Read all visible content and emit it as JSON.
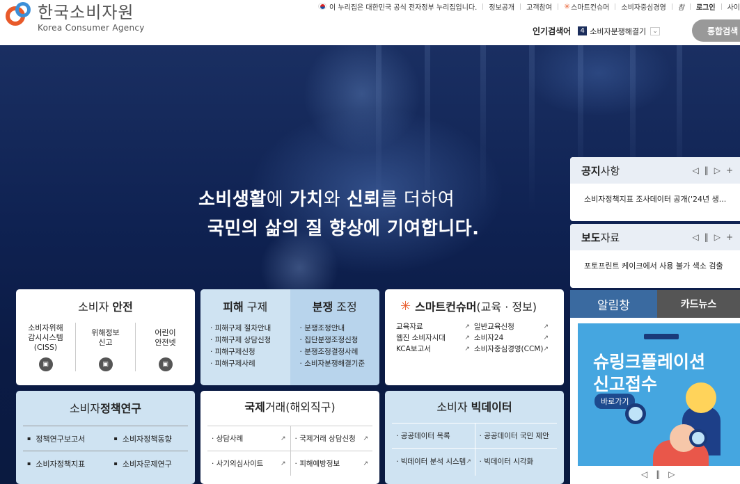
{
  "header": {
    "logo": {
      "ko": "한국소비자원",
      "en": "Korea Consumer Agency"
    },
    "topbar": {
      "gov_notice": "이 누리집은 대한민국 공식 전자정부 누리집입니다.",
      "links": [
        "정보공개",
        "고객참여",
        "스마트컨슈머",
        "소비자중심경영"
      ],
      "chakan": "참",
      "login": "로그인",
      "cut": "사이"
    },
    "popular": {
      "label": "인기검색어",
      "rank": "4",
      "keyword": "소비자분쟁해결기"
    },
    "search_button": "통합검색"
  },
  "hero": {
    "line1": {
      "a": "소비생활",
      "b": "에 ",
      "c": "가치",
      "d": "와 ",
      "e": "신뢰",
      "f": "를 더하여"
    },
    "line2": "국민의 삶의 질 향상에 기여합니다."
  },
  "notice": {
    "title_bold": "공지",
    "title_rest": "사항",
    "item": "소비자정책지표 조사데이터 공개('24년 생..."
  },
  "press": {
    "title_bold": "보도",
    "title_rest": "자료",
    "item": "포토프린트 케이크에서 사용 불가 색소 검출"
  },
  "controls": {
    "prev": "◁",
    "pause": "‖",
    "next": "▷",
    "plus": "+"
  },
  "alarm": {
    "tab1": "알림창",
    "tab2": "카드뉴스",
    "banner_line1": "슈링크플레이션",
    "banner_line2": "신고접수",
    "banner_go": "바로가기"
  },
  "cards": {
    "safety": {
      "title_rest": "소비자 ",
      "title_bold": "안전",
      "items": [
        {
          "l1": "소비자위해",
          "l2": "감시시스템",
          "l3": "(CISS)"
        },
        {
          "l1": "위해정보",
          "l2": "신고",
          "l3": ""
        },
        {
          "l1": "어린이",
          "l2": "안전넷",
          "l3": ""
        }
      ]
    },
    "relief": {
      "title_bold": "피해",
      "title_rest": " 구제",
      "items": [
        "피해구제 절차안내",
        "피해구제 상담신청",
        "피해구제신청",
        "피해구제사례"
      ]
    },
    "dispute": {
      "title_bold": "분쟁",
      "title_rest": " 조정",
      "items": [
        "분쟁조정안내",
        "집단분쟁조정신청",
        "분쟁조정결정사례",
        "소비자분쟁해결기준"
      ]
    },
    "smart": {
      "title_bold": "스마트컨슈머",
      "title_rest": "(교육 · 정보)",
      "left": [
        "교육자료",
        "웹진 소비자시대",
        "KCA보고서"
      ],
      "right": [
        "일반교육신청",
        "소비자24",
        "소비자중심경영(CCM)"
      ]
    },
    "policy": {
      "title_rest": "소비자",
      "title_bold": "정책연구",
      "items": [
        "정책연구보고서",
        "소비자정책동향",
        "소비자정책지표",
        "소비자문제연구"
      ]
    },
    "intl": {
      "title_bold": "국제",
      "title_rest": "거래(해외직구)",
      "items": [
        "상담사례",
        "국제거래 상담신청",
        "사기의심사이트",
        "피해예방정보"
      ]
    },
    "bigdata": {
      "title_rest": "소비자 ",
      "title_bold": "빅데이터",
      "items": [
        "공공데이터 목록",
        "공공데이터 국민 제안",
        "빅데이터 분석 시스템",
        "빅데이터 시각화"
      ]
    }
  },
  "colors": {
    "accent_orange": "#e85a2a",
    "accent_blue": "#3c8fd8",
    "navy": "#1c2e5c",
    "card_blue": "#cfe3f2"
  }
}
